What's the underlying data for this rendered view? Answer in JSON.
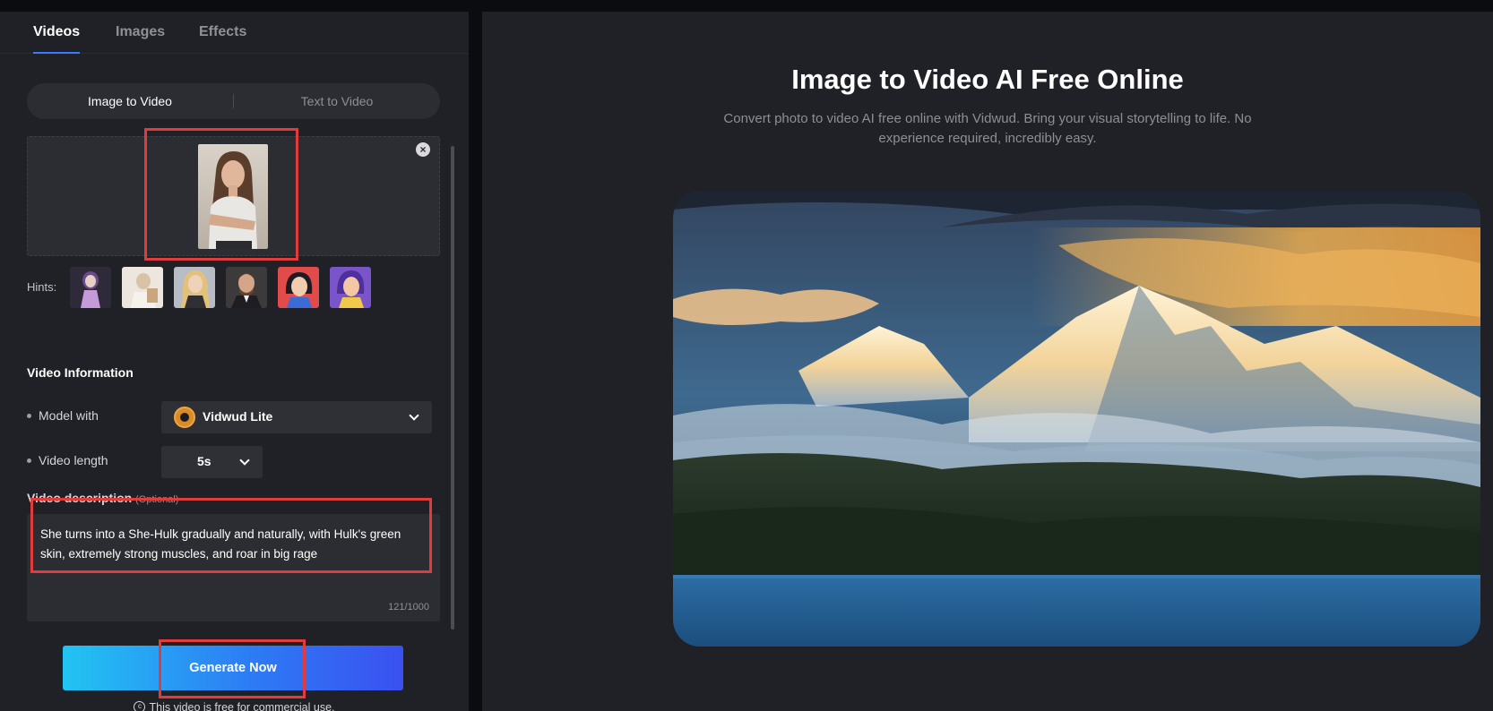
{
  "tabs": [
    {
      "label": "Videos",
      "active": true
    },
    {
      "label": "Images",
      "active": false
    },
    {
      "label": "Effects",
      "active": false
    }
  ],
  "mode": {
    "image_to_video": "Image to Video",
    "text_to_video": "Text to Video",
    "selected": "Image to Video"
  },
  "hints": {
    "label": "Hints:"
  },
  "video_info": {
    "title": "Video Information",
    "model_label": "Model with",
    "model_value": "Vidwud Lite",
    "length_label": "Video length",
    "length_value": "5s",
    "desc_label": "Video description",
    "desc_optional": "(Optional)",
    "desc_text": "She turns into a She-Hulk gradually and naturally, with Hulk's green skin, extremely strong muscles, and roar in big rage",
    "counter": "121/1000"
  },
  "generate": {
    "label": "Generate Now"
  },
  "note": {
    "text": "This video is free for commercial use."
  },
  "hero": {
    "title": "Image to Video AI Free Online",
    "subtitle": "Convert photo to video AI free online with Vidwud. Bring your visual storytelling to life. No experience required, incredibly easy."
  },
  "colors": {
    "accent": "#3a7bff",
    "highlight": "#e23b3b",
    "panel_bg": "#202126",
    "page_bg": "#0b0c10"
  }
}
